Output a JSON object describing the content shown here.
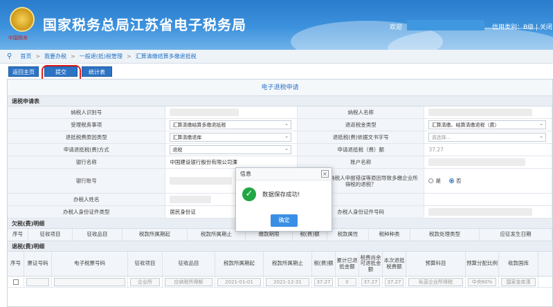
{
  "header": {
    "site_title": "国家税务总局江苏省电子税务局",
    "emblem_subtitle": "中国税务",
    "welcome": "欢迎",
    "credit": "信用类别：B级 | 关闭"
  },
  "breadcrumb": [
    "首页",
    "我要办税",
    "一般退(抵)税管理",
    "汇算清缴结算多缴退抵税"
  ],
  "toolbar": {
    "back_home": "返回主页",
    "submit": "提交",
    "stats": "统计表"
  },
  "panel_title": "电子退税申请",
  "section_refund": "退税申请表",
  "form": {
    "taxpayer_id_label": "纳税人识别号",
    "taxpayer_name_label": "纳税人名称",
    "matter_label": "受理税务事项",
    "matter_value": "汇算清缴结算多缴退抵税",
    "refund_type_label": "退返税金类型",
    "refund_type_value": "汇算清缴、结算清缴退税（费）",
    "refund_reason_label": "退抵税费原因类型",
    "refund_reason_value": "汇算清缴退库",
    "doc_type_label": "退抵税(费)依据文书字号",
    "doc_type_value": "请选择...",
    "method_label": "申请退抵税(费)方式",
    "method_value": "退税",
    "amount_label": "申请退抵税（费）额",
    "amount_value": "37.27",
    "bank_label": "银行名称",
    "bank_value": "中国建设银行股份有限公司溧",
    "account_name_label": "账户名称",
    "account_no_label": "银行账号",
    "question_label": "是否属于因纳税人申报错误等原因导致多缴企业所得税的退税？",
    "radio_yes": "是",
    "radio_no": "否",
    "handler_label": "办税人姓名",
    "handler_id_type_label": "办税人身份证件类型",
    "handler_id_type_value": "居民身份证",
    "handler_id_no_label": "办税人身份证件号码"
  },
  "section_tax_owed": "欠税(费)明细",
  "owed_headers": [
    "序号",
    "征收项目",
    "征收品目",
    "税款所属期起",
    "税款所属期止",
    "缴款期限",
    "税(费)额",
    "税款属性",
    "税种种类",
    "税款处理类型",
    "应征发生日期"
  ],
  "section_refund_detail": "退税(费)明细",
  "refund_headers": [
    "序号",
    "票证号码",
    "电子税票号码",
    "征收项目",
    "征收品目",
    "税款所属期起",
    "税款所属期止",
    "税(费)额",
    "累计已退抵金额",
    "税费尚余可退抵金额",
    "本次退抵税费额",
    "预算科目",
    "预算分配比例",
    "收款国库"
  ],
  "refund_row": [
    "",
    "",
    "",
    "企业所",
    "应纳税所得额",
    "2021-01-01",
    "2021-12-31",
    "37.27",
    "0",
    "37.27",
    "37.27",
    "私营企业所得税",
    "中央60%",
    "国家金库溧"
  ],
  "modal": {
    "title": "信息",
    "message": "数据保存成功!",
    "ok": "确定",
    "close": "×"
  },
  "colors": {
    "brand_blue": "#2c73c4",
    "highlight_red": "#e02020",
    "success_green": "#22a745"
  }
}
